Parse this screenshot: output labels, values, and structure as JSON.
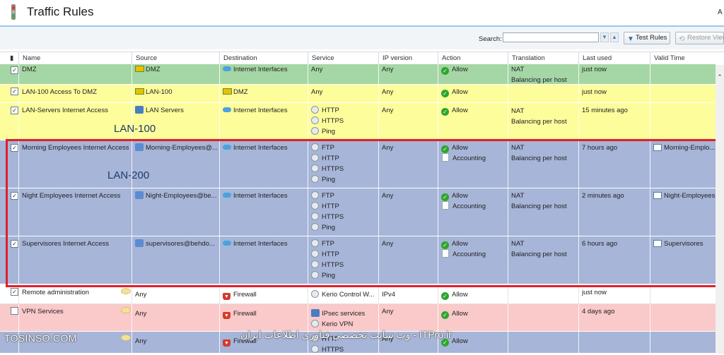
{
  "window": {
    "title": "Traffic Rules",
    "right_char": "A"
  },
  "toolbar": {
    "search_label": "Search:",
    "search_value": "",
    "test_rules_label": "Test Rules",
    "restore_view_label": "Restore View"
  },
  "columns": [
    "Name",
    "Source",
    "Destination",
    "Service",
    "IP version",
    "Action",
    "Translation",
    "Last used",
    "Valid Time"
  ],
  "colors": {
    "green_row": "#a5d6a5",
    "yellow_row": "#fdfd9c",
    "blue_row": "#a6b5d8",
    "white_row": "#ffffff",
    "red_row": "#fac9c9",
    "highlight_box": "#e0202a"
  },
  "annotations": {
    "lan100": "LAN-100",
    "lan200": "LAN-200"
  },
  "rules": [
    {
      "checked": true,
      "name": "DMZ",
      "source": [
        "DMZ"
      ],
      "destination": [
        "Internet Interfaces"
      ],
      "service": [
        "Any"
      ],
      "ip": "Any",
      "action": [
        "Allow"
      ],
      "translation": [
        "NAT",
        "Balancing per host"
      ],
      "last_used": "just now",
      "valid_time": ""
    },
    {
      "checked": true,
      "name": "LAN-100 Access To DMZ",
      "source": [
        "LAN-100"
      ],
      "destination": [
        "DMZ"
      ],
      "service": [
        "Any"
      ],
      "ip": "Any",
      "action": [
        "Allow"
      ],
      "translation": [],
      "last_used": "just now",
      "valid_time": ""
    },
    {
      "checked": true,
      "name": "LAN-Servers Internet Access",
      "source": [
        "LAN Servers"
      ],
      "destination": [
        "Internet Interfaces"
      ],
      "service": [
        "HTTP",
        "HTTPS",
        "Ping"
      ],
      "ip": "Any",
      "action": [
        "Allow"
      ],
      "translation": [
        "NAT",
        "Balancing per host"
      ],
      "last_used": "15 minutes ago",
      "valid_time": ""
    },
    {
      "checked": true,
      "name": "Morning Employees Internet Access",
      "source": [
        "Morning-Employees@..."
      ],
      "destination": [
        "Internet Interfaces"
      ],
      "service": [
        "FTP",
        "HTTP",
        "HTTPS",
        "Ping"
      ],
      "ip": "Any",
      "action": [
        "Allow",
        "Accounting"
      ],
      "translation": [
        "NAT",
        "Balancing per host"
      ],
      "last_used": "7 hours ago",
      "valid_time": "Morning-Emplo..."
    },
    {
      "checked": true,
      "name": "Night Employees Internet Access",
      "source": [
        "Night-Employees@be..."
      ],
      "destination": [
        "Internet Interfaces"
      ],
      "service": [
        "FTP",
        "HTTP",
        "HTTPS",
        "Ping"
      ],
      "ip": "Any",
      "action": [
        "Allow",
        "Accounting"
      ],
      "translation": [
        "NAT",
        "Balancing per host"
      ],
      "last_used": "2 minutes ago",
      "valid_time": "Night-Employees"
    },
    {
      "checked": true,
      "name": "Supervisores Internet Access",
      "source": [
        "supervisores@behdo..."
      ],
      "destination": [
        "Internet Interfaces"
      ],
      "service": [
        "FTP",
        "HTTP",
        "HTTPS",
        "Ping"
      ],
      "ip": "Any",
      "action": [
        "Allow",
        "Accounting"
      ],
      "translation": [
        "NAT",
        "Balancing per host"
      ],
      "last_used": "6 hours ago",
      "valid_time": "Supervisores"
    },
    {
      "checked": true,
      "name": "Remote administration",
      "source": [
        "Any"
      ],
      "destination": [
        "Firewall"
      ],
      "service": [
        "Kerio Control W..."
      ],
      "ip": "IPv4",
      "action": [
        "Allow"
      ],
      "translation": [],
      "last_used": "just now",
      "valid_time": ""
    },
    {
      "checked": false,
      "name": "VPN Services",
      "source": [
        "Any"
      ],
      "destination": [
        "Firewall"
      ],
      "service": [
        "IPsec services",
        "Kerio VPN"
      ],
      "ip": "Any",
      "action": [
        "Allow"
      ],
      "translation": [],
      "last_used": "4 days ago",
      "valid_time": ""
    },
    {
      "checked": true,
      "name": "",
      "source": [
        "Any"
      ],
      "destination": [
        "Firewall"
      ],
      "service": [
        "HTTP",
        "HTTPS"
      ],
      "ip": "Any",
      "action": [
        "Allow"
      ],
      "translation": [],
      "last_used": "",
      "valid_time": ""
    }
  ],
  "watermarks": {
    "left": "TOSINSO.COM",
    "right": "ITPro.ir - وب سایت تخصصی فناوری اطلاعات ایران"
  }
}
